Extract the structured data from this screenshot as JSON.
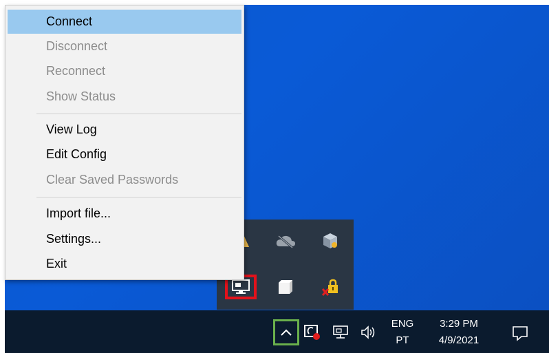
{
  "menu": {
    "items": [
      {
        "label": "Connect",
        "enabled": true,
        "highlighted": true
      },
      {
        "label": "Disconnect",
        "enabled": false
      },
      {
        "label": "Reconnect",
        "enabled": false
      },
      {
        "label": "Show Status",
        "enabled": false
      },
      {
        "label": "View Log",
        "enabled": true
      },
      {
        "label": "Edit Config",
        "enabled": true
      },
      {
        "label": "Clear Saved Passwords",
        "enabled": false
      },
      {
        "label": "Import file...",
        "enabled": true
      },
      {
        "label": "Settings...",
        "enabled": true
      },
      {
        "label": "Exit",
        "enabled": true
      }
    ]
  },
  "tray_overflow": {
    "icons": [
      "warning-icon",
      "onedrive-offline-icon",
      "package-icon",
      "openvpn-monitor-icon",
      "white-cube-icon",
      "lock-error-icon"
    ]
  },
  "taskbar": {
    "language_top": "ENG",
    "language_bottom": "PT",
    "time": "3:29 PM",
    "date": "4/9/2021"
  },
  "colors": {
    "desktop": "#0a58cf",
    "taskbar": "#0b1b2e",
    "menu_highlight": "#99c9ef",
    "red_highlight": "#e3121b",
    "green_highlight": "#6ab04c"
  }
}
